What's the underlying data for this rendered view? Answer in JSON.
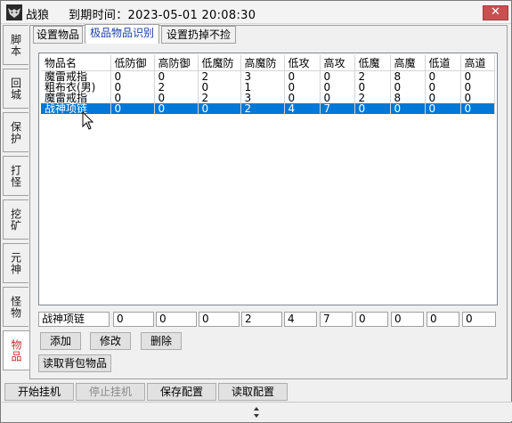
{
  "window": {
    "title": "战狼",
    "expiry": "到期时间：2023-05-01 20:08:30",
    "close_label": "✕"
  },
  "side_tabs": [
    "脚本",
    "回城",
    "保护",
    "打怪",
    "挖矿",
    "元神",
    "怪物",
    "物品"
  ],
  "active_side_tab": "物品",
  "top_tabs": [
    "设置物品",
    "极品物品识别",
    "设置扔掉不捡"
  ],
  "active_top_tab": "极品物品识别",
  "table": {
    "columns": [
      "物品名",
      "低防御",
      "高防御",
      "低魔防",
      "高魔防",
      "低攻",
      "高攻",
      "低魔",
      "高魔",
      "低道",
      "高道"
    ],
    "rows": [
      [
        "魔雷戒指",
        "0",
        "0",
        "2",
        "3",
        "0",
        "0",
        "2",
        "8",
        "0",
        "0"
      ],
      [
        "粗布衣(男)",
        "0",
        "2",
        "0",
        "1",
        "0",
        "0",
        "0",
        "0",
        "0",
        "0"
      ],
      [
        "魔雷戒指",
        "0",
        "0",
        "2",
        "3",
        "0",
        "0",
        "2",
        "8",
        "0",
        "0"
      ],
      [
        "战神项链",
        "0",
        "0",
        "0",
        "2",
        "4",
        "7",
        "0",
        "0",
        "0",
        "0"
      ]
    ],
    "selected_row": 3
  },
  "edit_fields": {
    "name": "战神项链",
    "values": [
      "0",
      "0",
      "0",
      "2",
      "4",
      "7",
      "0",
      "0",
      "0",
      "0"
    ]
  },
  "buttons": {
    "add": "添加",
    "modify": "修改",
    "delete": "删除",
    "read_bag": "读取背包物品"
  },
  "bottom_buttons": {
    "start": "开始挂机",
    "stop": "停止挂机",
    "save": "保存配置",
    "load": "读取配置"
  },
  "colors": {
    "selection": "#0078d7",
    "active_side_tab_text": "#c83030",
    "active_top_tab_text": "#1a3ea8",
    "close_button": "#c75050"
  }
}
